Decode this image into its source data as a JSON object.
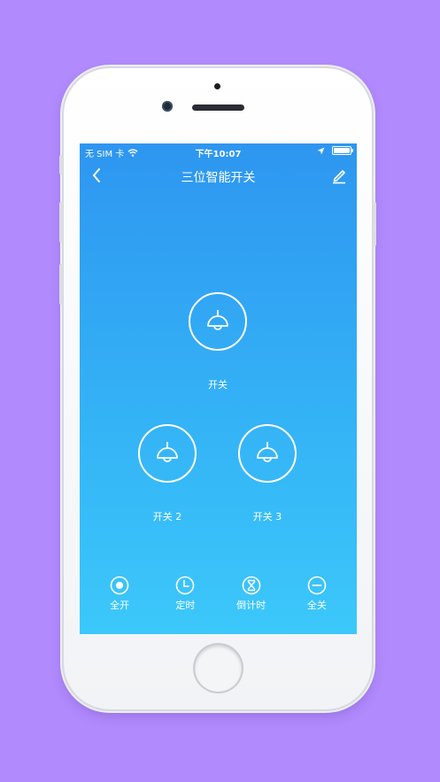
{
  "status_bar": {
    "carrier": "无 SIM 卡",
    "time": "下午10:07"
  },
  "nav": {
    "title": "三位智能开关"
  },
  "switches": [
    {
      "label": "开关"
    },
    {
      "label": "开关 2"
    },
    {
      "label": "开关 3"
    }
  ],
  "toolbar": [
    {
      "label": "全开",
      "icon": "power-on-icon"
    },
    {
      "label": "定时",
      "icon": "clock-icon"
    },
    {
      "label": "倒计时",
      "icon": "hourglass-icon"
    },
    {
      "label": "全关",
      "icon": "power-off-icon"
    }
  ],
  "colors": {
    "background": "#b18afd",
    "screen_top": "#2e96f0",
    "screen_bottom": "#3cc8fa"
  }
}
